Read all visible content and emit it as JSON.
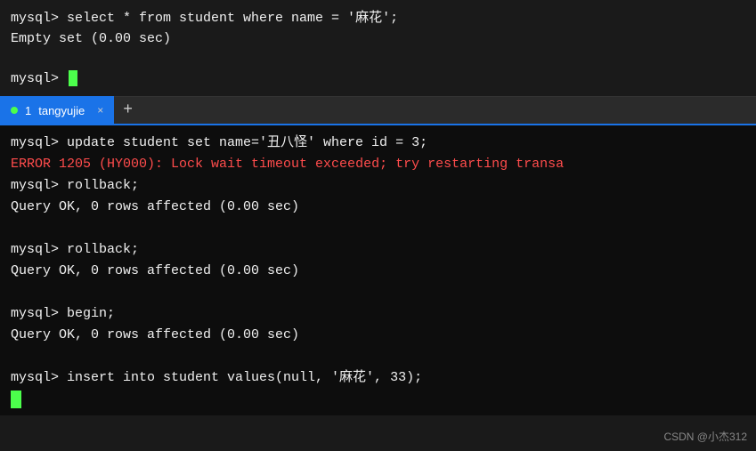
{
  "top_terminal": {
    "lines": [
      "mysql> select * from student where name = '麻花';",
      "Empty set (0.00 sec)",
      "",
      "mysql> "
    ]
  },
  "tab_bar": {
    "tab_number": "1",
    "tab_name": "tangyujie",
    "close_symbol": "×",
    "add_symbol": "+"
  },
  "bottom_terminal": {
    "lines": [
      {
        "text": "mysql> update student set name='丑八怪' where id = 3;",
        "type": "normal"
      },
      {
        "text": "ERROR 1205 (HY000): Lock wait timeout exceeded; try restarting transa",
        "type": "error"
      },
      {
        "text": "mysql> rollback;",
        "type": "normal"
      },
      {
        "text": "Query OK, 0 rows affected (0.00 sec)",
        "type": "normal"
      },
      {
        "text": "",
        "type": "normal"
      },
      {
        "text": "mysql> rollback;",
        "type": "normal"
      },
      {
        "text": "Query OK, 0 rows affected (0.00 sec)",
        "type": "normal"
      },
      {
        "text": "",
        "type": "normal"
      },
      {
        "text": "mysql> begin;",
        "type": "normal"
      },
      {
        "text": "Query OK, 0 rows affected (0.00 sec)",
        "type": "normal"
      },
      {
        "text": "",
        "type": "normal"
      },
      {
        "text": "mysql> insert into student values(null, '麻花', 33);",
        "type": "normal"
      }
    ]
  },
  "watermark": {
    "text": "CSDN @小杰312"
  }
}
